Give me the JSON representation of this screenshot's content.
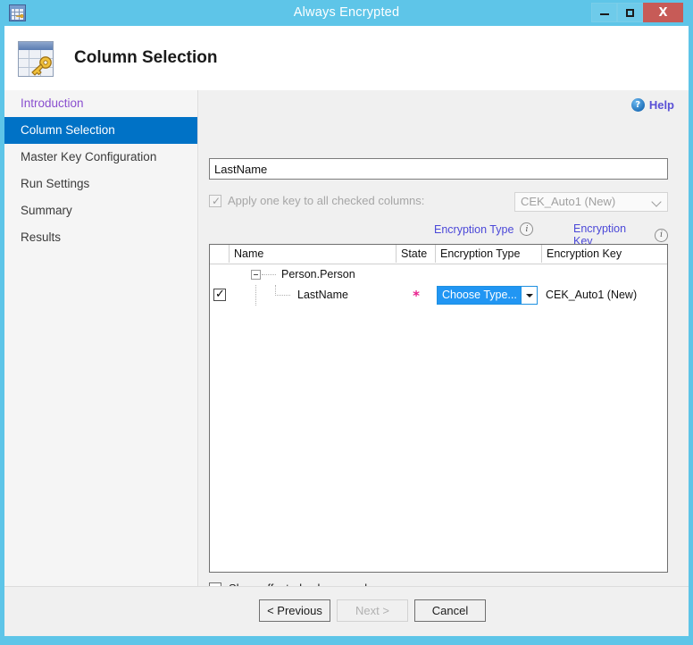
{
  "window": {
    "title": "Always Encrypted",
    "icon": "table-key-icon",
    "controls": {
      "minimize": "minimize-icon",
      "maximize": "maximize-icon",
      "close": "X"
    }
  },
  "header": {
    "title": "Column Selection",
    "icon": "table-key-icon"
  },
  "sidebar": {
    "items": [
      {
        "label": "Introduction",
        "state": "visited"
      },
      {
        "label": "Column Selection",
        "state": "active"
      },
      {
        "label": "Master Key Configuration",
        "state": "normal"
      },
      {
        "label": "Run Settings",
        "state": "normal"
      },
      {
        "label": "Summary",
        "state": "normal"
      },
      {
        "label": "Results",
        "state": "normal"
      }
    ]
  },
  "content": {
    "help": {
      "label": "Help",
      "icon": "help-question-icon"
    },
    "filter": {
      "value": "LastName",
      "placeholder": ""
    },
    "apply_key": {
      "label": "Apply one key to all checked columns:",
      "checked": true,
      "disabled": true,
      "selected_key": "CEK_Auto1 (New)"
    },
    "links": [
      {
        "label": "Encryption Type",
        "icon": "info-icon"
      },
      {
        "label": "Encryption Key",
        "icon": "info-icon"
      }
    ],
    "grid": {
      "columns": [
        "",
        "Name",
        "State",
        "Encryption Type",
        "Encryption Key"
      ],
      "rows": [
        {
          "type": "node",
          "name": "Person.Person",
          "expanded": true,
          "state": "",
          "encryption_type": "",
          "encryption_key": ""
        },
        {
          "type": "leaf",
          "name": "LastName",
          "checked": true,
          "state": "*",
          "encryption_type": "Choose Type...",
          "encryption_key": "CEK_Auto1 (New)"
        }
      ]
    },
    "show_affected": {
      "label": "Show affected columns only",
      "checked": false
    }
  },
  "footer": {
    "previous": "< Previous",
    "next": "Next >",
    "cancel": "Cancel"
  },
  "colors": {
    "titlebar": "#5ec5e8",
    "accent": "#0072c6",
    "close": "#c75b57",
    "link": "#4b48d8",
    "visited": "#8a4fcf",
    "required_star": "#e8208d",
    "combo_selected": "#2196f3"
  }
}
